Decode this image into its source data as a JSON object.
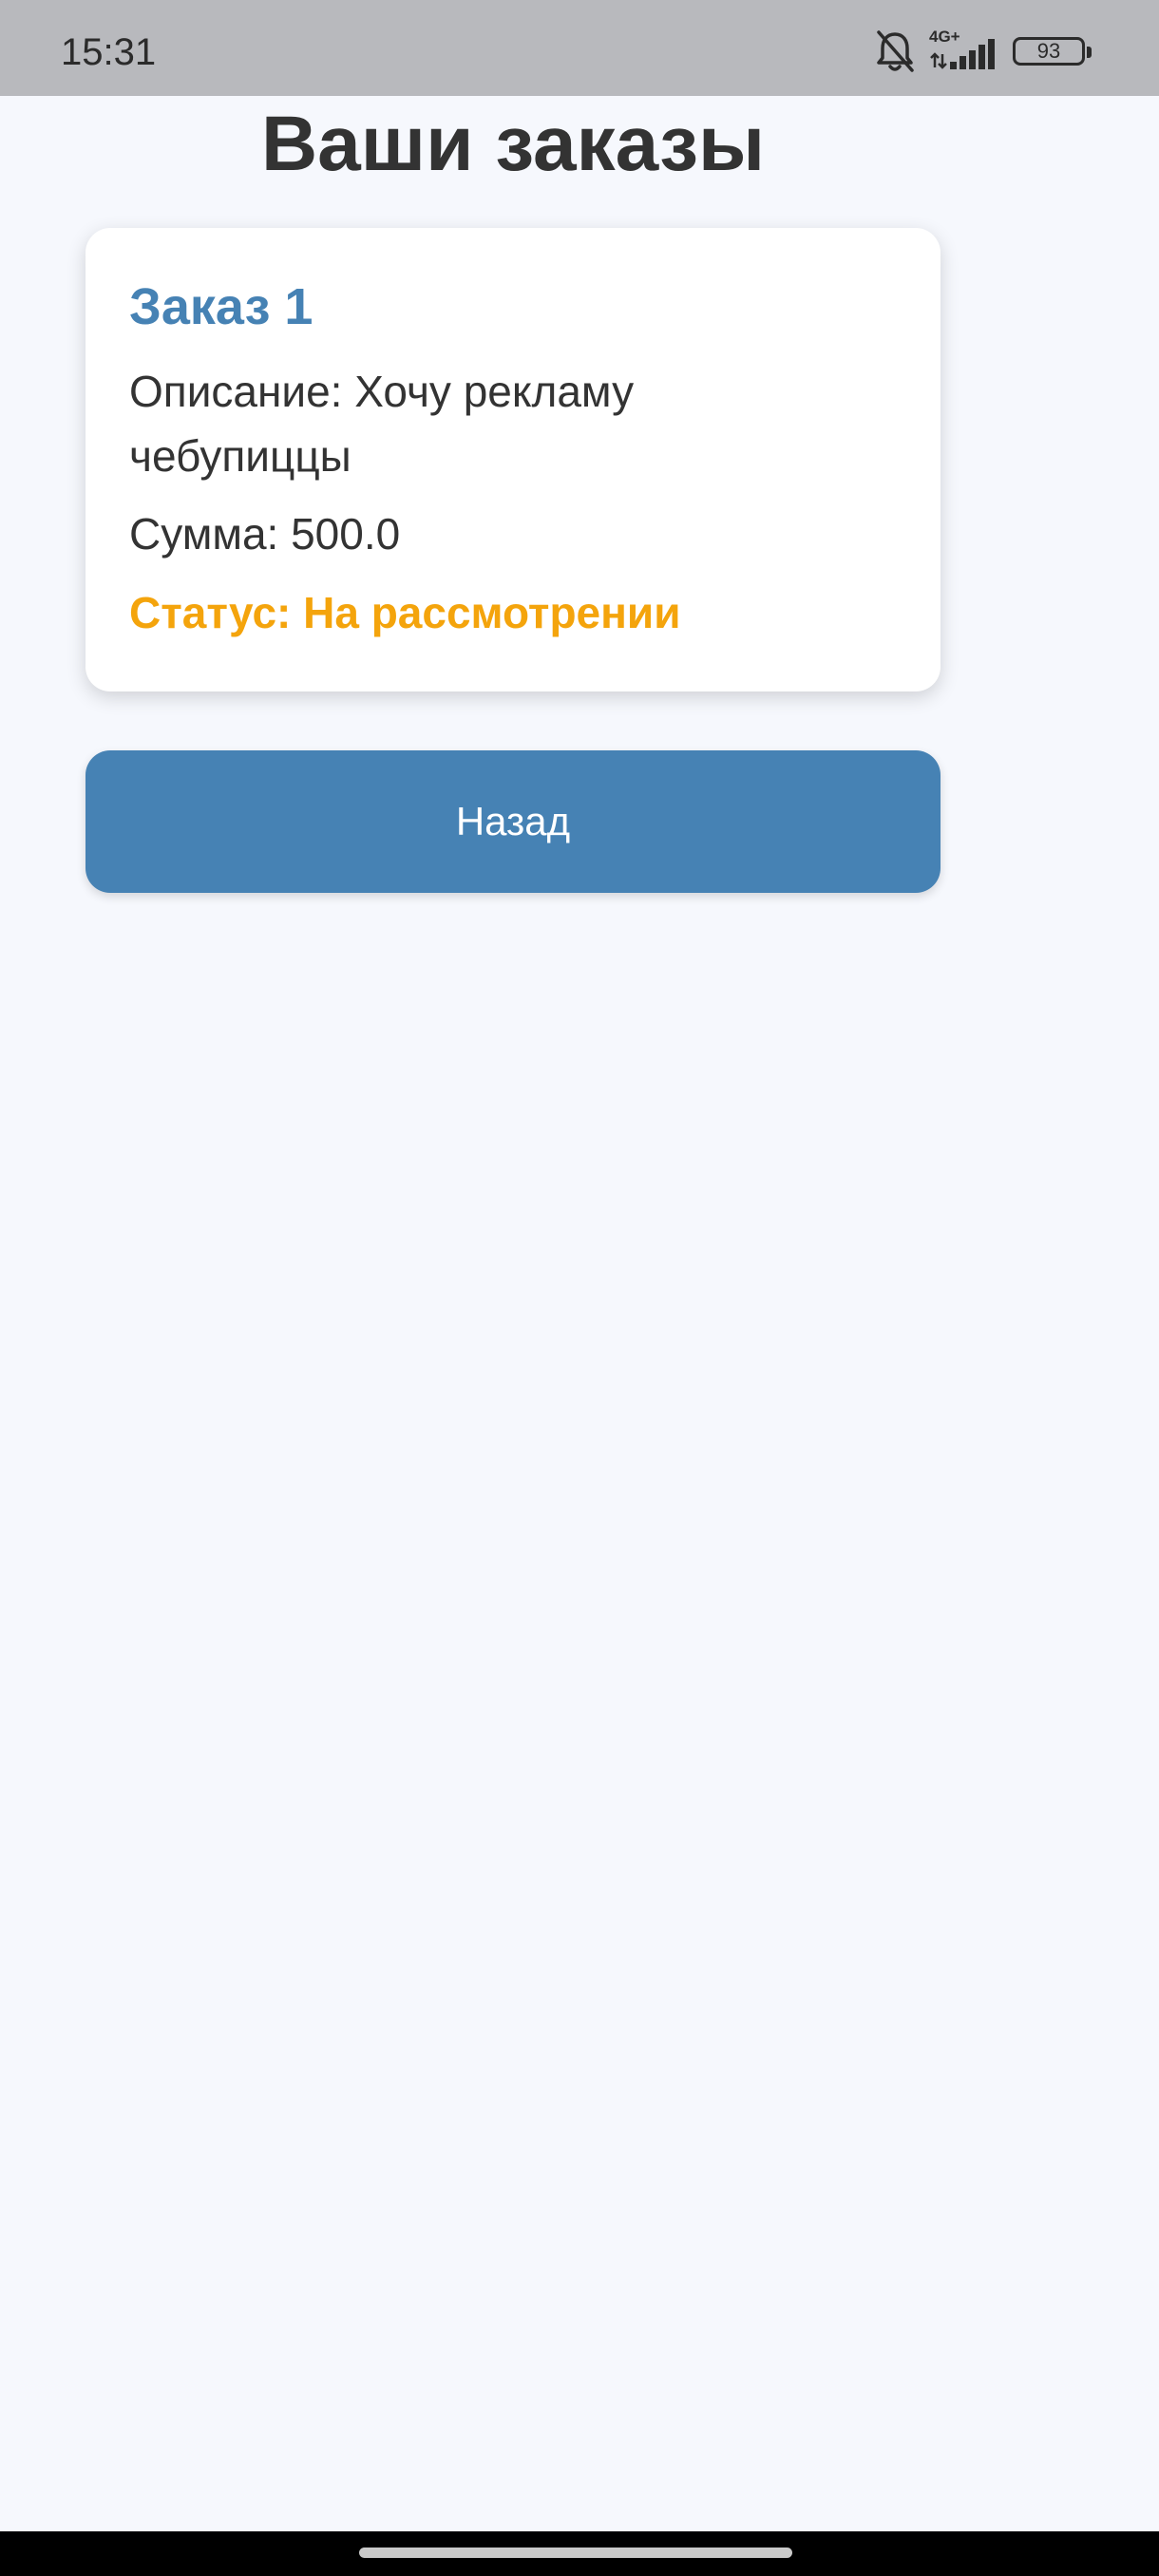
{
  "status_bar": {
    "time": "15:31",
    "network_label": "4G+",
    "battery_level": "93",
    "icons": [
      "bell-off-icon",
      "signal-icon",
      "battery-icon"
    ]
  },
  "page": {
    "title": "Ваши заказы"
  },
  "orders": [
    {
      "title": "Заказ 1",
      "description": "Описание: Хочу рекламу чебупиццы",
      "sum": "Сумма: 500.0",
      "status": "Статус: На рассмотрении"
    }
  ],
  "actions": {
    "back_label": "Назад"
  },
  "colors": {
    "accent": "#4682b4",
    "status_pending": "#f4a40c",
    "background": "#f6f8fd",
    "card": "#ffffff",
    "status_bar": "#b8b9bd"
  }
}
